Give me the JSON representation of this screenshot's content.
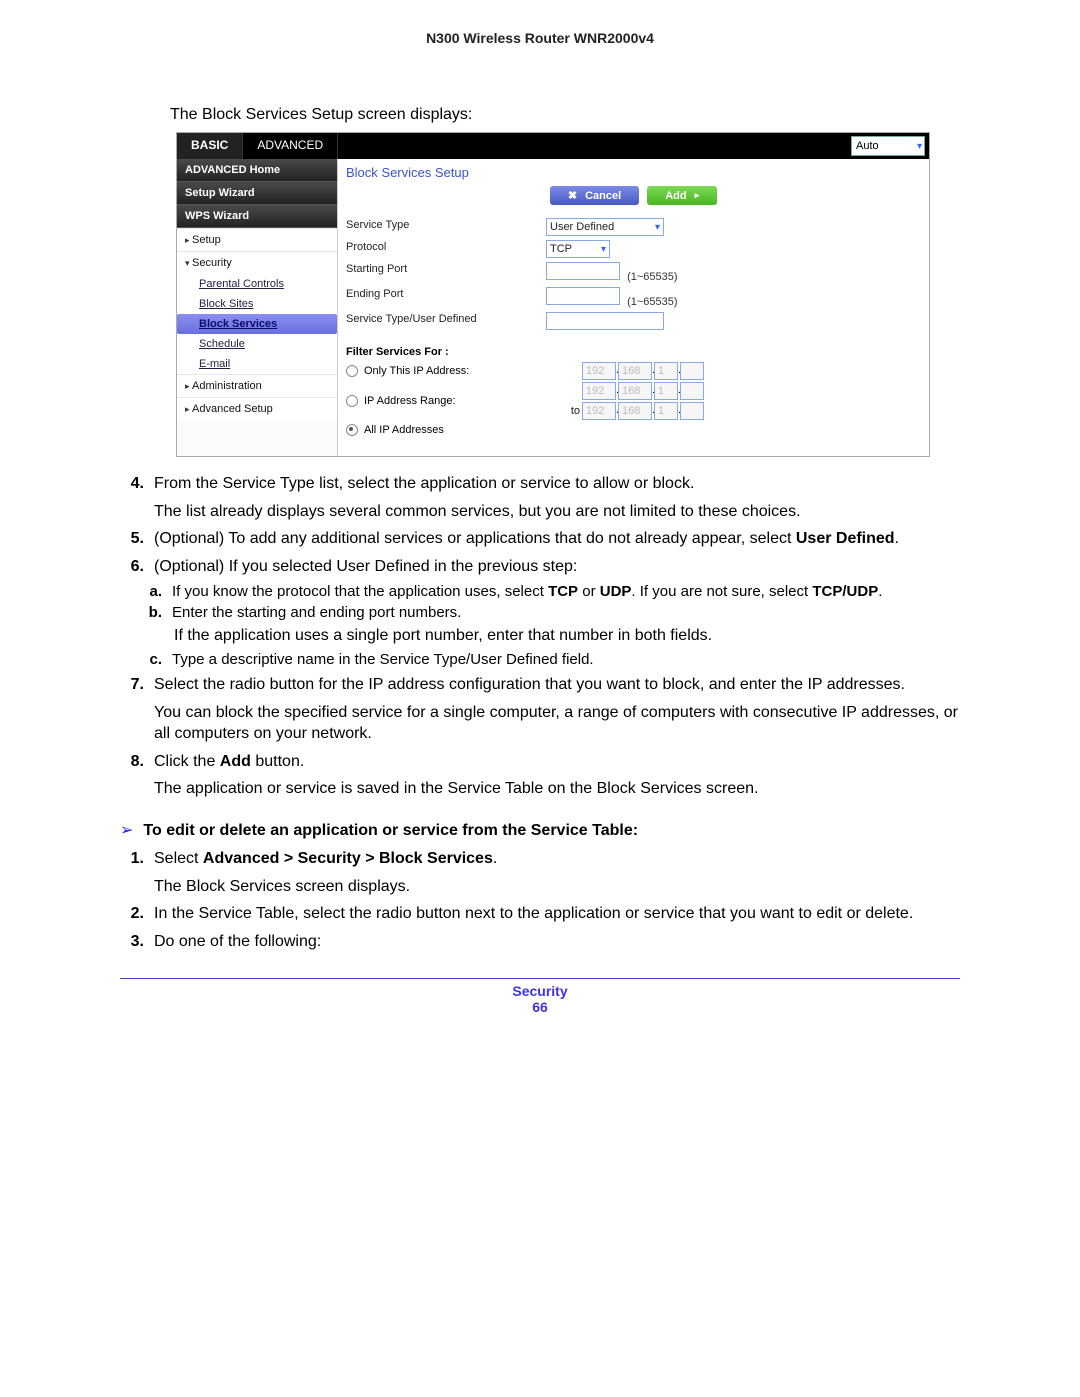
{
  "doc": {
    "header": "N300 Wireless Router WNR2000v4",
    "intro": "The Block Services Setup screen displays:",
    "footer_label": "Security",
    "page_number": "66"
  },
  "router": {
    "tabs": {
      "basic": "BASIC",
      "advanced": "ADVANCED"
    },
    "top_select": "Auto",
    "sidebar": {
      "adv_home": "ADVANCED Home",
      "setup_wizard": "Setup Wizard",
      "wps_wizard": "WPS Wizard",
      "setup": "Setup",
      "security": "Security",
      "subs": {
        "parental": "Parental Controls",
        "block_sites": "Block Sites",
        "block_services": "Block Services",
        "schedule": "Schedule",
        "email": "E-mail"
      },
      "administration": "Administration",
      "advanced_setup": "Advanced Setup"
    },
    "main": {
      "title": "Block Services Setup",
      "cancel": "Cancel",
      "add": "Add",
      "labels": {
        "service_type": "Service Type",
        "protocol": "Protocol",
        "start_port": "Starting Port",
        "end_port": "Ending Port",
        "user_def": "Service Type/User Defined",
        "filter_head": "Filter Services For :",
        "only_this": "Only This IP Address:",
        "ip_range": "IP Address Range:",
        "to": "to",
        "all_ip": "All IP Addresses"
      },
      "values": {
        "service_type": "User Defined",
        "protocol": "TCP",
        "port_hint": "(1~65535)",
        "ip_a": "192",
        "ip_b": "168",
        "ip_c": "1",
        "ip_d": ""
      }
    }
  },
  "steps": {
    "n4": "4.",
    "t4": "From the Service Type list, select the application or service to allow or block.",
    "t4b": "The list already displays several common services, but you are not limited to these choices.",
    "n5": "5.",
    "t5a": "(Optional) To add any additional services or applications that do not already appear, select ",
    "t5b": "User Defined",
    "dot": ".",
    "n6": "6.",
    "t6": "(Optional) If you selected User Defined in the previous step:",
    "la": "a.",
    "ta_1": "If you know the protocol that the application uses, select ",
    "ta_tcp": "TCP",
    "ta_or": " or ",
    "ta_udp": "UDP",
    "ta_2": ". If you are not sure, select ",
    "ta_tcpudp": "TCP/UDP",
    "lb": "b.",
    "tb": "Enter the starting and ending port numbers.",
    "tb2": "If the application uses a single port number, enter that number in both fields.",
    "lc": "c.",
    "tc": "Type a descriptive name in the Service Type/User Defined field.",
    "n7": "7.",
    "t7": "Select the radio button for the IP address configuration that you want to block, and enter the IP addresses.",
    "t7b": "You can block the specified service for a single computer, a range of computers with consecutive IP addresses, or all computers on your network.",
    "n8": "8.",
    "t8a": "Click the ",
    "t8_add": "Add",
    "t8b": " button.",
    "t8c": "The application or service is saved in the Service Table on the Block Services screen.",
    "proc_arrow": "➢",
    "proc_title": "To edit or delete an application or service from the Service Table:",
    "n1": "1.",
    "t1a": "Select ",
    "t1_path": "Advanced > Security > Block Services",
    "t1c": "The Block Services screen displays.",
    "n2": "2.",
    "t2": "In the Service Table, select the radio button next to the application or service that you want to edit or delete.",
    "n3": "3.",
    "t3": "Do one of the following:"
  }
}
